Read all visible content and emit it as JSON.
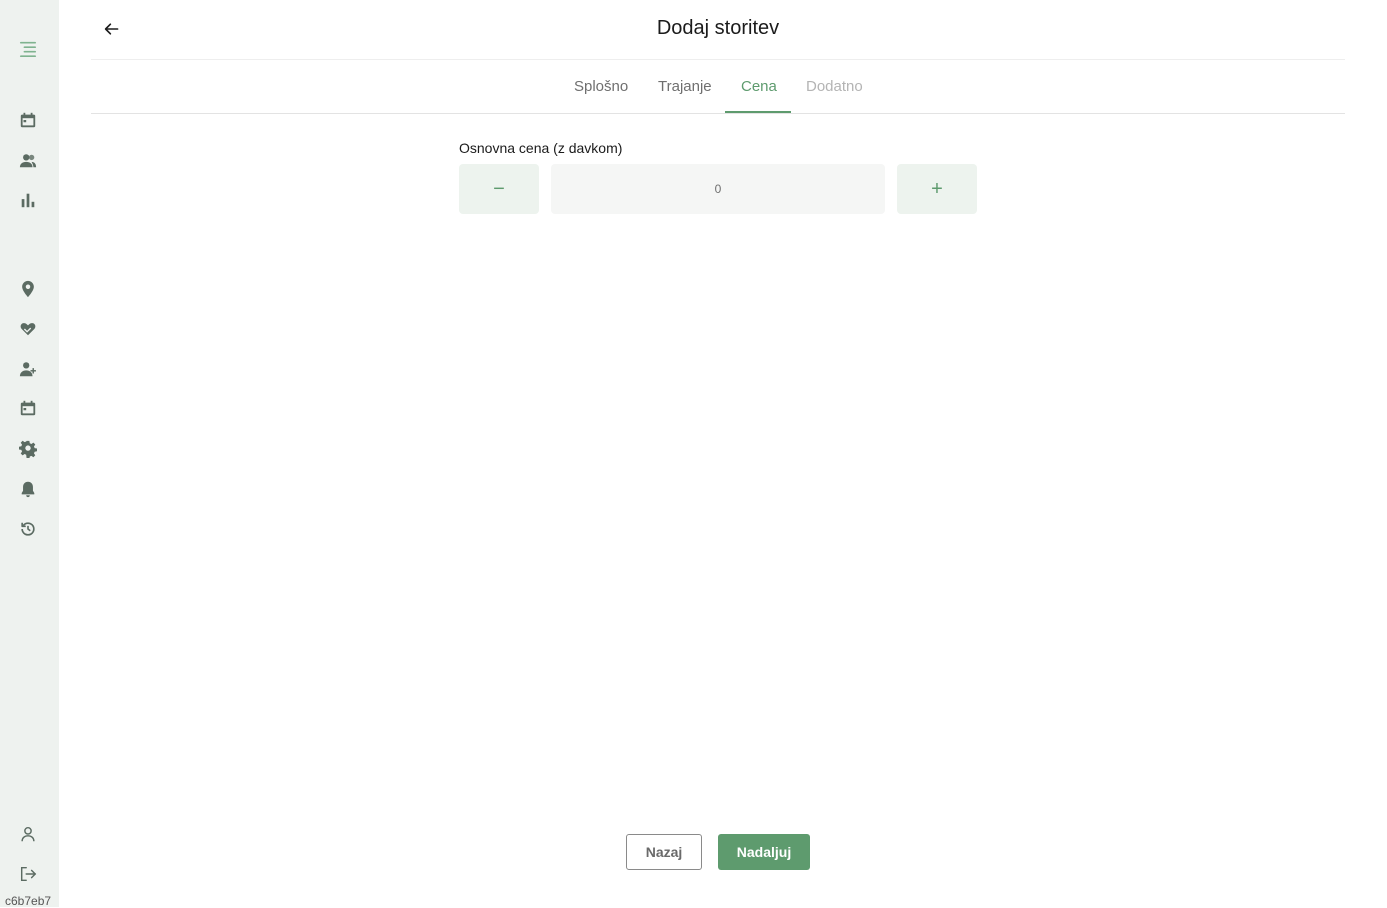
{
  "app": {
    "version": "c6b7eb7",
    "accent_color": "#5e9b6e"
  },
  "sidebar": {
    "items": [
      {
        "icon": "menu-icon"
      },
      {
        "icon": "calendar-icon"
      },
      {
        "icon": "users-icon"
      },
      {
        "icon": "bar-chart-icon"
      },
      {
        "icon": "location-pin-icon"
      },
      {
        "icon": "handshake-heart-icon"
      },
      {
        "icon": "add-user-icon"
      },
      {
        "icon": "calendar-icon"
      },
      {
        "icon": "gear-icon"
      },
      {
        "icon": "bell-icon"
      },
      {
        "icon": "history-icon"
      },
      {
        "icon": "profile-icon"
      },
      {
        "icon": "logout-icon"
      }
    ]
  },
  "header": {
    "title": "Dodaj storitev",
    "back_icon": "arrow-left-icon"
  },
  "tabs": [
    {
      "label": "Splošno",
      "state": "normal"
    },
    {
      "label": "Trajanje",
      "state": "normal"
    },
    {
      "label": "Cena",
      "state": "active"
    },
    {
      "label": "Dodatno",
      "state": "disabled"
    }
  ],
  "price": {
    "label": "Osnovna cena (z davkom)",
    "value": "0",
    "decrement_symbol": "−",
    "increment_symbol": "+"
  },
  "footer": {
    "back_label": "Nazaj",
    "next_label": "Nadaljuj"
  }
}
